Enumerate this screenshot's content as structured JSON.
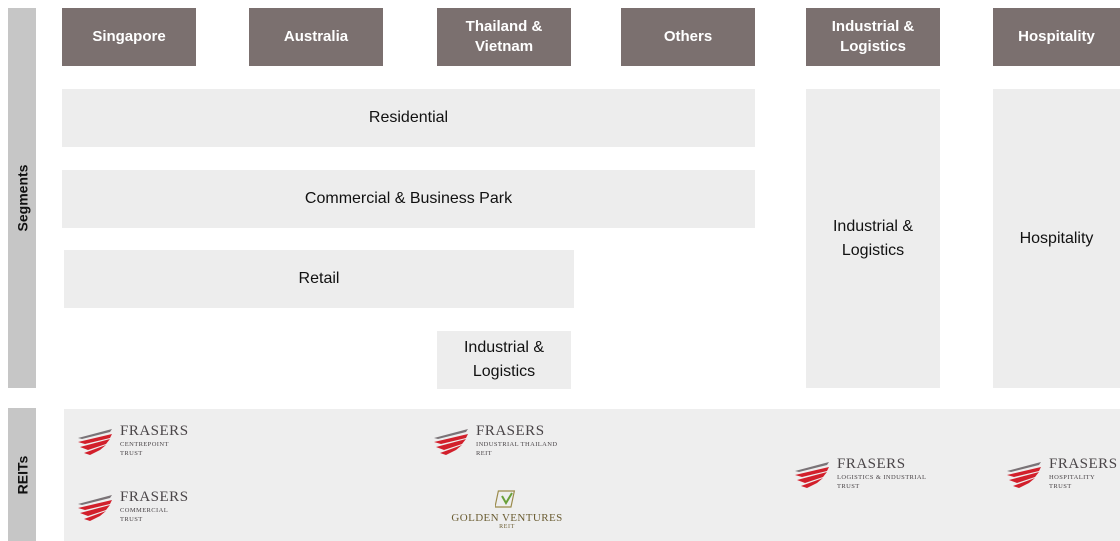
{
  "sidebars": {
    "segments_label": "Segments",
    "reits_label": "REITs"
  },
  "headers": [
    "Singapore",
    "Australia",
    "Thailand & Vietnam",
    "Others",
    "Industrial & Logistics",
    "Hospitality"
  ],
  "segments": {
    "residential": "Residential",
    "commercial": "Commercial & Business Park",
    "retail": "Retail",
    "industrial_small": "Industrial & Logistics",
    "industrial_column": "Industrial & Logistics",
    "hospitality_column": "Hospitality"
  },
  "reits": [
    {
      "brand": "FRASERS",
      "sub1": "CENTREPOINT",
      "sub2": "TRUST",
      "icon": "frasers-wing-logo"
    },
    {
      "brand": "FRASERS",
      "sub1": "COMMERCIAL",
      "sub2": "TRUST",
      "icon": "frasers-wing-logo"
    },
    {
      "brand": "FRASERS",
      "sub1": "INDUSTRIAL THAILAND",
      "sub2": "REIT",
      "icon": "frasers-wing-logo"
    },
    {
      "brand": "GOLDEN VENTURES",
      "sub1": "REIT",
      "sub2": "",
      "icon": "golden-ventures-logo"
    },
    {
      "brand": "FRASERS",
      "sub1": "LOGISTICS & INDUSTRIAL",
      "sub2": "TRUST",
      "icon": "frasers-wing-logo"
    },
    {
      "brand": "FRASERS",
      "sub1": "HOSPITALITY",
      "sub2": "TRUST",
      "icon": "frasers-wing-logo"
    }
  ],
  "colors": {
    "header_bg": "#7b706f",
    "segment_bg": "#ededed",
    "sidebar_bg": "#c6c6c6",
    "logo_red": "#d21f2b"
  }
}
